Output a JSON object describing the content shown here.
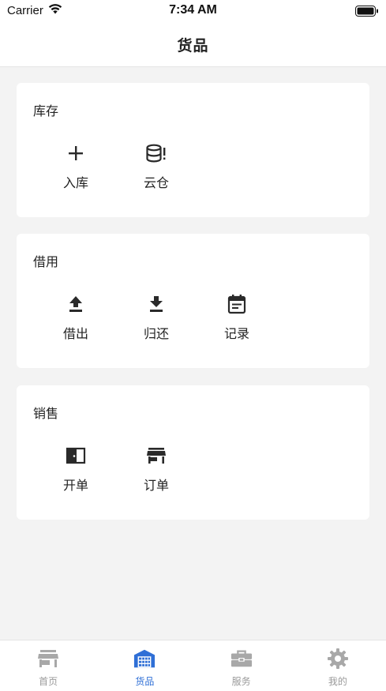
{
  "status_bar": {
    "carrier": "Carrier",
    "time": "7:34 AM",
    "wifi_icon": "wifi-icon",
    "battery_icon": "battery-icon"
  },
  "nav": {
    "title": "货品"
  },
  "sections": [
    {
      "title": "库存",
      "items": [
        {
          "label": "入库",
          "icon": "plus-icon"
        },
        {
          "label": "云仓",
          "icon": "database-alert-icon"
        }
      ]
    },
    {
      "title": "借用",
      "items": [
        {
          "label": "借出",
          "icon": "upload-icon"
        },
        {
          "label": "归还",
          "icon": "download-icon"
        },
        {
          "label": "记录",
          "icon": "calendar-list-icon"
        }
      ]
    },
    {
      "title": "销售",
      "items": [
        {
          "label": "开单",
          "icon": "door-icon"
        },
        {
          "label": "订单",
          "icon": "store-icon"
        }
      ]
    }
  ],
  "tab_bar": {
    "tabs": [
      {
        "label": "首页",
        "icon": "store-front-icon",
        "active": false
      },
      {
        "label": "货品",
        "icon": "warehouse-icon",
        "active": true
      },
      {
        "label": "服务",
        "icon": "toolbox-icon",
        "active": false
      },
      {
        "label": "我的",
        "icon": "gear-icon",
        "active": false
      }
    ]
  },
  "colors": {
    "accent": "#2f6fd6",
    "inactive": "#9a9a9a",
    "background": "#f3f3f3",
    "card": "#ffffff"
  }
}
